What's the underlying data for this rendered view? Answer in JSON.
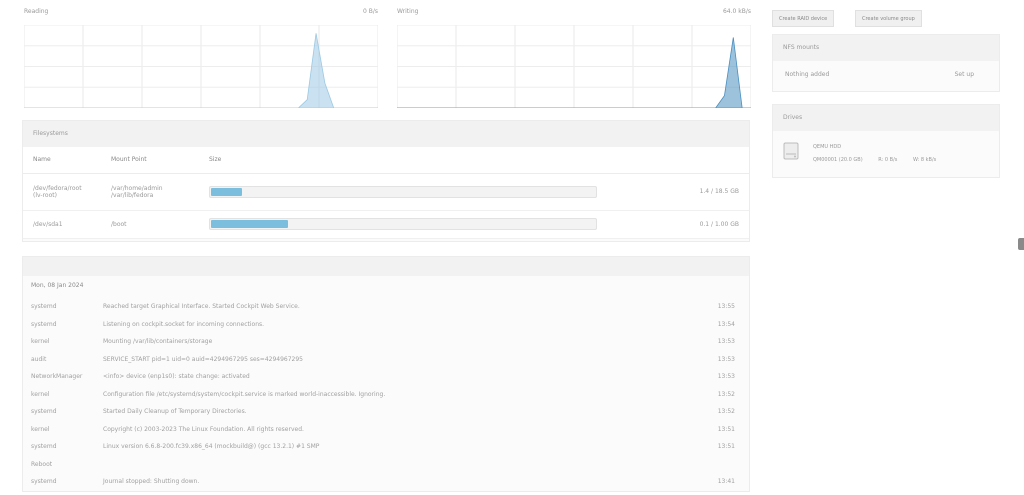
{
  "charts": {
    "left": {
      "title": "Reading",
      "value": "0 B/s"
    },
    "right": {
      "title": "Writing",
      "value": "64.0 kB/s"
    }
  },
  "chart_data": [
    {
      "type": "area",
      "title": "Reading",
      "ylim": [
        0,
        1
      ],
      "x": [
        0,
        1,
        2,
        3,
        4,
        5,
        6,
        7,
        8,
        9,
        10,
        11,
        12,
        13,
        14,
        15,
        16,
        17,
        18,
        19,
        20,
        21,
        22,
        23,
        24,
        25,
        26,
        27,
        28,
        29,
        30,
        31,
        32,
        33,
        34,
        35,
        36,
        37,
        38,
        39,
        40
      ],
      "values": [
        0,
        0,
        0,
        0,
        0,
        0,
        0,
        0,
        0,
        0,
        0,
        0,
        0,
        0,
        0,
        0,
        0,
        0,
        0,
        0,
        0,
        0,
        0,
        0,
        0,
        0,
        0,
        0,
        0,
        0,
        0,
        0,
        0.1,
        0.9,
        0.3,
        0,
        0,
        0,
        0,
        0,
        0
      ]
    },
    {
      "type": "area",
      "title": "Writing",
      "ylim": [
        0,
        1
      ],
      "x": [
        0,
        1,
        2,
        3,
        4,
        5,
        6,
        7,
        8,
        9,
        10,
        11,
        12,
        13,
        14,
        15,
        16,
        17,
        18,
        19,
        20,
        21,
        22,
        23,
        24,
        25,
        26,
        27,
        28,
        29,
        30,
        31,
        32,
        33,
        34,
        35,
        36,
        37,
        38,
        39,
        40
      ],
      "values": [
        0,
        0,
        0,
        0,
        0,
        0,
        0,
        0,
        0,
        0,
        0,
        0,
        0,
        0,
        0,
        0,
        0,
        0,
        0,
        0,
        0,
        0,
        0,
        0,
        0,
        0,
        0,
        0,
        0,
        0,
        0,
        0,
        0,
        0,
        0,
        0,
        0,
        0.15,
        0.85,
        0,
        0
      ]
    }
  ],
  "filesystems": {
    "heading": "Filesystems",
    "columns": [
      "Name",
      "Mount Point",
      "Size"
    ],
    "rows": [
      {
        "name": "/dev/fedora/root",
        "name2": "(lv-root)",
        "mount": "/var/home/admin",
        "mount2": "/var/lib/fedora",
        "percent": 8,
        "usage": "1.4 / 18.5 GB"
      },
      {
        "name": "/dev/sda1",
        "name2": "",
        "mount": "/boot",
        "percent": 20,
        "usage": "0.1 / 1.00 GB"
      }
    ]
  },
  "journal": {
    "heading": "",
    "date": "Mon, 08 Jan 2024",
    "entries": [
      {
        "level": "systemd",
        "msg": "Reached target Graphical Interface. Started Cockpit Web Service.",
        "time": "13:55"
      },
      {
        "level": "systemd",
        "msg": "Listening on cockpit.socket for incoming connections.",
        "time": "13:54"
      },
      {
        "level": "kernel",
        "msg": "Mounting /var/lib/containers/storage",
        "time": "13:53"
      },
      {
        "level": "audit",
        "msg": "SERVICE_START pid=1 uid=0 auid=4294967295 ses=4294967295",
        "time": "13:53"
      },
      {
        "level": "NetworkManager",
        "msg": "<info> device (enp1s0): state change: activated",
        "time": "13:53"
      },
      {
        "level": "kernel",
        "msg": "Configuration file /etc/systemd/system/cockpit.service is marked world-inaccessible. Ignoring.",
        "time": "13:52"
      },
      {
        "level": "systemd",
        "msg": "Started Daily Cleanup of Temporary Directories.",
        "time": "13:52"
      },
      {
        "level": "kernel",
        "msg": "Copyright (c) 2003-2023 The Linux Foundation. All rights reserved.",
        "time": "13:51"
      },
      {
        "level": "systemd",
        "msg": "Linux version 6.6.8-200.fc39.x86_64 (mockbuild@) (gcc 13.2.1) #1 SMP",
        "time": "13:51"
      },
      {
        "level": "Reboot",
        "msg": "",
        "time": ""
      },
      {
        "level": "systemd",
        "msg": "Journal stopped: Shutting down.",
        "time": "13:41"
      }
    ]
  },
  "buttons": {
    "left": "Create RAID device",
    "right": "Create volume group"
  },
  "nfs": {
    "heading": "NFS mounts",
    "key": "Nothing added",
    "value": "Set up"
  },
  "drives": {
    "heading": "Drives",
    "items": [
      {
        "name": "QEMU HDD",
        "serial": "QM00001 (20.0 GB)",
        "read": "R: 0 B/s",
        "write": "W: 8 kB/s"
      }
    ]
  }
}
